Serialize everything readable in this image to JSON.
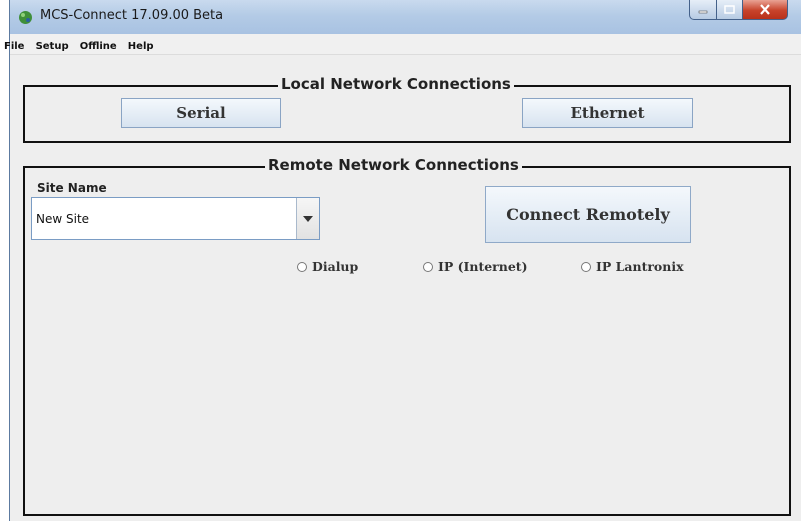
{
  "window": {
    "title": "MCS-Connect 17.09.00 Beta"
  },
  "menu": {
    "items": [
      "File",
      "Setup",
      "Offline",
      "Help"
    ]
  },
  "local": {
    "legend": "Local Network Connections",
    "serial_label": "Serial",
    "ethernet_label": "Ethernet"
  },
  "remote": {
    "legend": "Remote Network Connections",
    "site_name_label": "Site Name",
    "site_value": "New Site",
    "connect_label": "Connect Remotely",
    "radios": [
      "Dialup",
      "IP (Internet)",
      "IP Lantronix"
    ]
  },
  "icons": {
    "app": "app-icon",
    "minimize": "minimize-icon",
    "maximize": "maximize-icon",
    "close": "close-icon",
    "dropdown": "chevron-down-icon",
    "radio": "radio-icon"
  },
  "colors": {
    "titlebar": "#b4cbe6",
    "close_button": "#c7432b",
    "button_border": "#8aa4c4"
  }
}
